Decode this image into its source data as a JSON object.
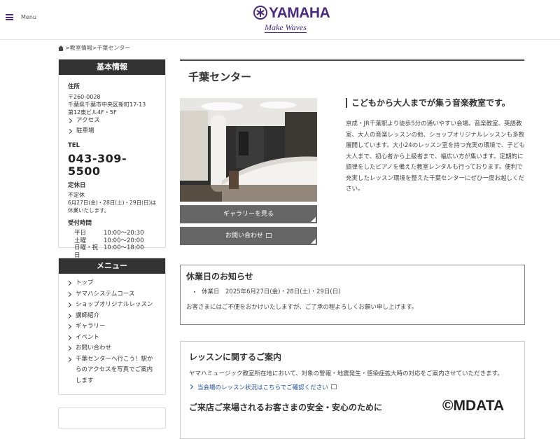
{
  "header": {
    "menu_label": "Menu",
    "logo_word": "YAMAHA",
    "logo_tagline": "Make Waves"
  },
  "breadcrumb": {
    "sep": ">",
    "items": [
      "教室情報",
      "千葉センター"
    ]
  },
  "basic_info": {
    "heading": "基本情報",
    "address_label": "住所",
    "postal": "〒260-0028",
    "address_line1": "千葉県千葉市中央区新町17-13",
    "address_line2": "第12東ビル4F・5F",
    "links": [
      "アクセス",
      "駐車場"
    ],
    "tel_label": "TEL",
    "tel": "043-309-5500",
    "closed_label": "定休日",
    "closed_value": "不定休",
    "closed_note": "6月27日(金)・28日(土)・29日(日)は休業いたします。",
    "hours_label": "受付時間",
    "hours": [
      {
        "day": "平日",
        "time": "10:00〜20:30"
      },
      {
        "day": "土曜",
        "time": "10:00〜20:00"
      },
      {
        "day": "日曜・祝日",
        "time": "10:00〜18:00"
      }
    ]
  },
  "menu": {
    "heading": "メニュー",
    "items": [
      "トップ",
      "ヤマハシステムコース",
      "ショップオリジナルレッスン",
      "講師紹介",
      "ギャラリー",
      "イベント",
      "お問い合わせ",
      "千葉センターへ行こう！駅からのアクセスを写真でご案内します"
    ]
  },
  "main": {
    "title": "千葉センター",
    "gallery_button": "ギャラリーを見る",
    "contact_button": "お問い合わせ",
    "intro_title": "こどもから大人までが集う音楽教室です。",
    "intro_text": "京成・JR千葉駅より徒歩5分の通いやすい会場。音楽教室、英語教室、大人の音楽レッスンの他、ショップオリジナルレッスンも多数展開しています。大小24のレッスン室を持つ充実の環境で、子ども 大人まで、初心者から上級者まで、幅広い方が集います。定期的に調律をしたピアノを備えた教室レンタルも行っております。便利で充実したレッスン環境を整えた千葉センターにぜひ一度お越しください。"
  },
  "notice": {
    "title": "休業日のお知らせ",
    "items": [
      "休業日　2025年6月27日(金)・28日(土)・29日(日)"
    ],
    "text": "お客さまにはご不便をおかけいたしますが、ご了承の程よろしくお願い申し上げます。"
  },
  "lesson_info": {
    "title": "レッスンに関するご案内",
    "text": "ヤマハミュージック教室所在地において、対象の警報・地震発生・感染症拡大時の対応をご案内させていただきます。",
    "link": "当会場のレッスン状況はこちらでご確認ください",
    "subtitle": "ご来店ご来場されるお客さまの安全・安心のために"
  },
  "watermark": "©MDATA"
}
